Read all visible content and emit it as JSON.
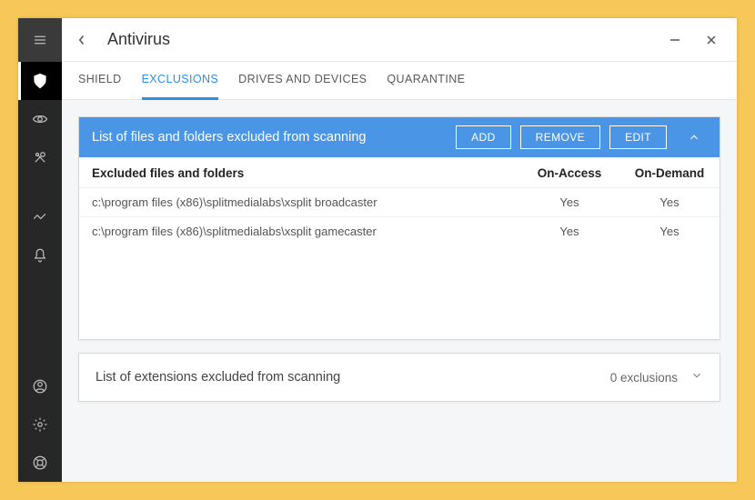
{
  "window": {
    "title": "Antivirus"
  },
  "tabs": [
    {
      "label": "SHIELD"
    },
    {
      "label": "EXCLUSIONS"
    },
    {
      "label": "DRIVES AND DEVICES"
    },
    {
      "label": "QUARANTINE"
    }
  ],
  "active_tab_index": 1,
  "exclusions_panel": {
    "title": "List of files and folders excluded from scanning",
    "add_label": "ADD",
    "remove_label": "REMOVE",
    "edit_label": "EDIT",
    "col_path": "Excluded files and folders",
    "col_access": "On-Access",
    "col_demand": "On-Demand",
    "rows": [
      {
        "path": "c:\\program files (x86)\\splitmedialabs\\xsplit broadcaster",
        "on_access": "Yes",
        "on_demand": "Yes"
      },
      {
        "path": "c:\\program files (x86)\\splitmedialabs\\xsplit gamecaster",
        "on_access": "Yes",
        "on_demand": "Yes"
      }
    ]
  },
  "extensions_panel": {
    "title": "List of extensions excluded from scanning",
    "count_label": "0 exclusions"
  }
}
